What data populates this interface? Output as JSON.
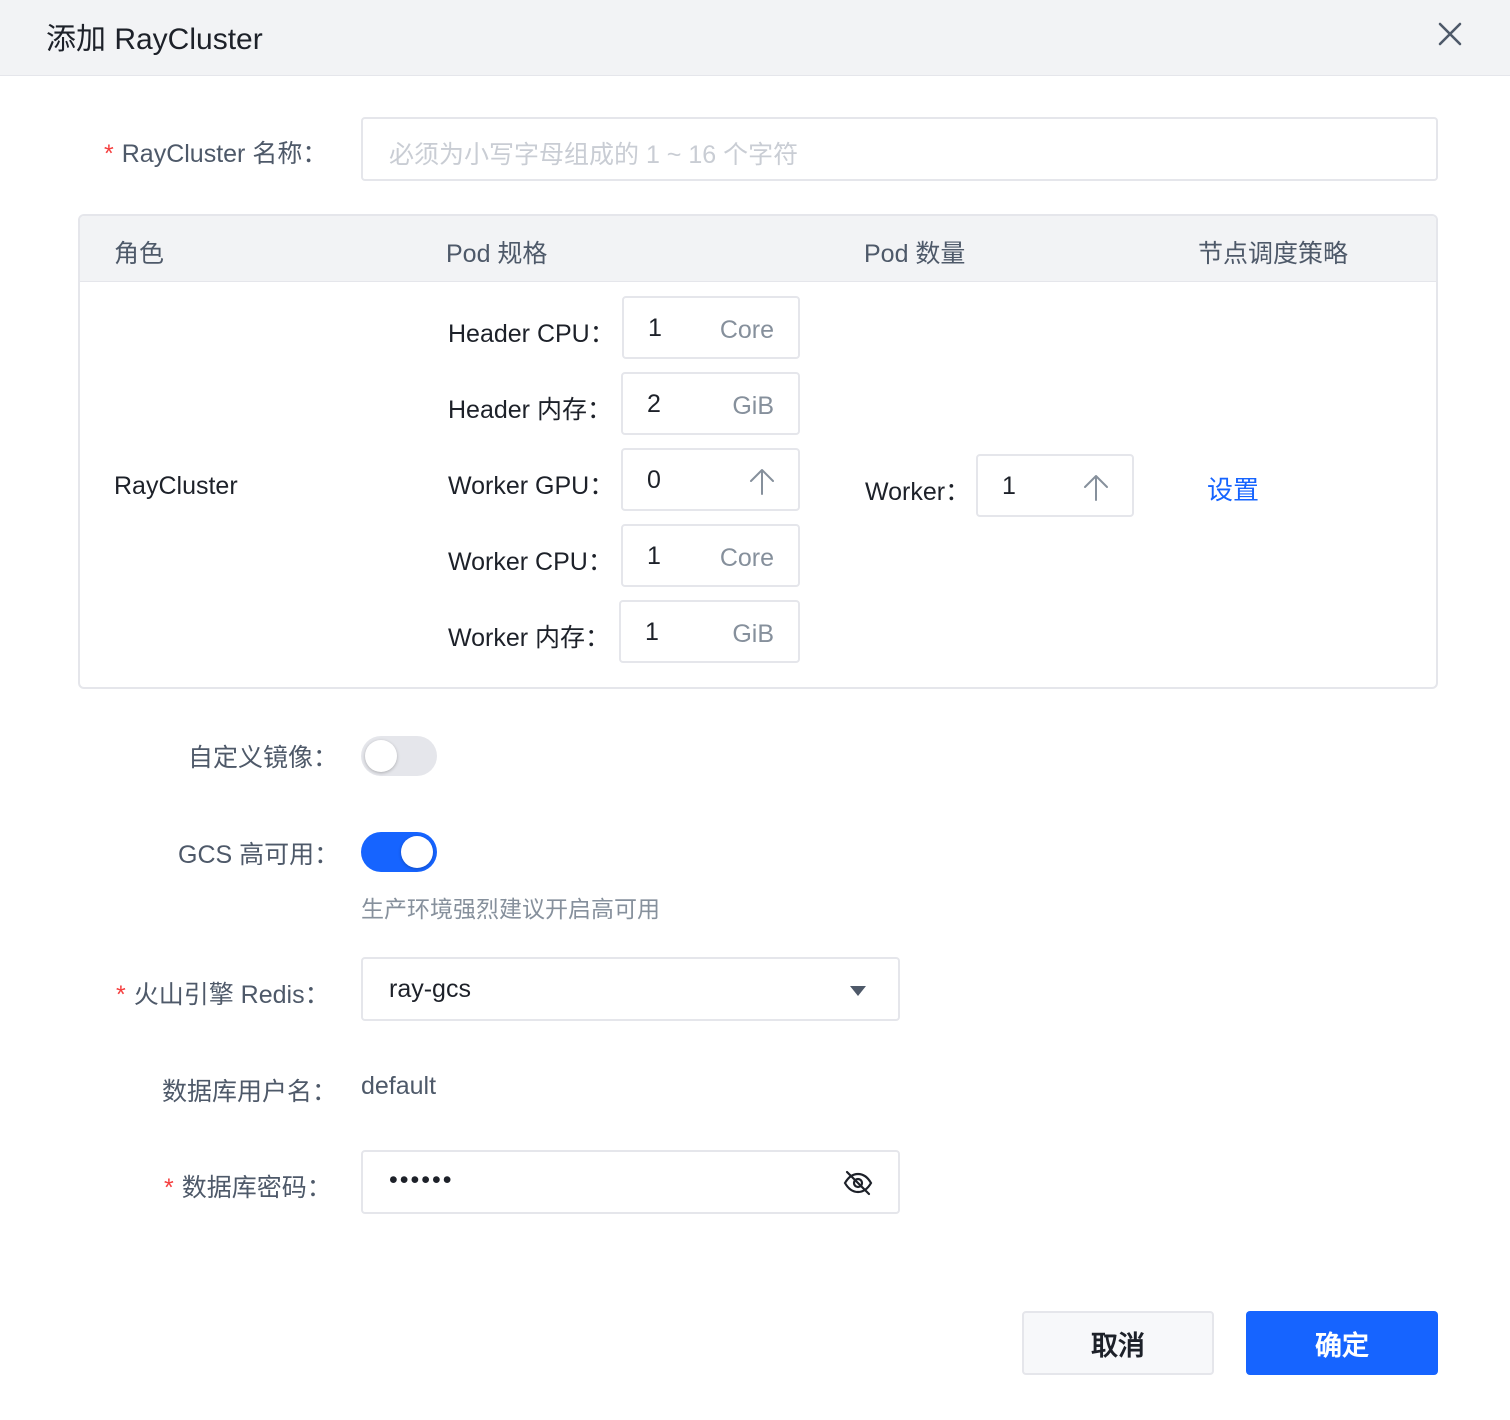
{
  "dialog": {
    "title": "添加 RayCluster"
  },
  "form": {
    "name": {
      "label": "RayCluster 名称：",
      "placeholder": "必须为小写字母组成的 1 ~ 16 个字符"
    },
    "table": {
      "headers": [
        "角色",
        "Pod 规格",
        "Pod 数量",
        "节点调度策略"
      ],
      "role": "RayCluster",
      "specs": [
        {
          "label": "Header CPU：",
          "value": "1",
          "unit": "Core"
        },
        {
          "label": "Header 内存：",
          "value": "2",
          "unit": "GiB"
        },
        {
          "label": "Worker GPU：",
          "value": "0",
          "unit": ""
        },
        {
          "label": "Worker CPU：",
          "value": "1",
          "unit": "Core"
        },
        {
          "label": "Worker 内存：",
          "value": "1",
          "unit": "GiB"
        }
      ],
      "worker_label": "Worker：",
      "worker_count": "1",
      "schedule_link": "设置"
    },
    "custom_image": {
      "label": "自定义镜像：",
      "enabled": false
    },
    "gcs": {
      "label": "GCS 高可用：",
      "enabled": true,
      "hint": "生产环境强烈建议开启高可用"
    },
    "redis": {
      "label": "火山引擎 Redis：",
      "value": "ray-gcs"
    },
    "db_user": {
      "label": "数据库用户名：",
      "value": "default"
    },
    "db_password": {
      "label": "数据库密码：",
      "value": "••••••"
    }
  },
  "footer": {
    "cancel": "取消",
    "confirm": "确定"
  },
  "colors": {
    "primary": "#1664ff",
    "required": "#f53f3f",
    "switch_off": "#e5e6eb",
    "header_bg": "#f2f3f5"
  },
  "icons": {
    "close": "close-icon",
    "stepper": "arrow-up-icon",
    "dropdown": "caret-down-icon",
    "password": "eye-off-icon"
  }
}
